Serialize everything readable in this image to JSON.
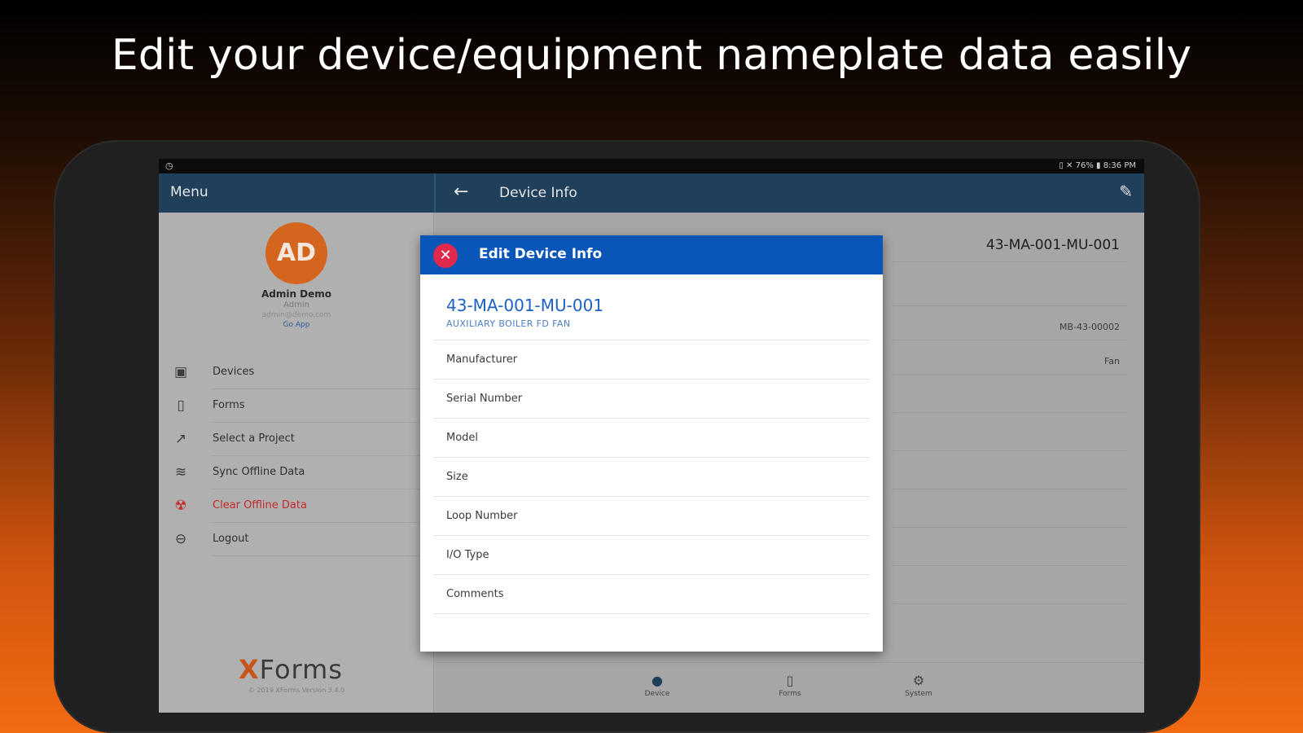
{
  "headline": "Edit your device/equipment nameplate data easily",
  "statusbar": {
    "status_text": "▯ ✕ 76% ▮ 8:36 PM"
  },
  "drawer": {
    "title": "Menu",
    "avatar_initials": "AD",
    "user_name": "Admin Demo",
    "user_role": "Admin",
    "user_email": "admin@demo.com",
    "user_link": "Go App",
    "items": [
      {
        "label": "Devices",
        "icon": "devices-icon"
      },
      {
        "label": "Forms",
        "icon": "forms-icon"
      },
      {
        "label": "Select a Project",
        "icon": "project-icon"
      },
      {
        "label": "Sync Offline Data",
        "icon": "sync-icon"
      },
      {
        "label": "Clear Offline Data",
        "icon": "clear-data-icon"
      },
      {
        "label": "Logout",
        "icon": "logout-icon"
      }
    ],
    "logo_x": "X",
    "logo_rest": "Forms",
    "copyright": "© 2019 XForms Version 3.4.0"
  },
  "main": {
    "title": "Device Info",
    "device_id": "43-MA-001-MU-001",
    "value_1": "MB-43-00002",
    "value_2": "Fan",
    "bottom_nav": [
      {
        "label": "Device",
        "icon": "info-icon"
      },
      {
        "label": "Forms",
        "icon": "forms-icon"
      },
      {
        "label": "System",
        "icon": "system-icon"
      }
    ]
  },
  "dialog": {
    "title": "Edit Device Info",
    "device_id": "43-MA-001-MU-001",
    "device_description": "AUXILIARY BOILER FD FAN",
    "fields": [
      "Manufacturer",
      "Serial Number",
      "Model",
      "Size",
      "Loop Number",
      "I/O Type",
      "Comments"
    ]
  }
}
